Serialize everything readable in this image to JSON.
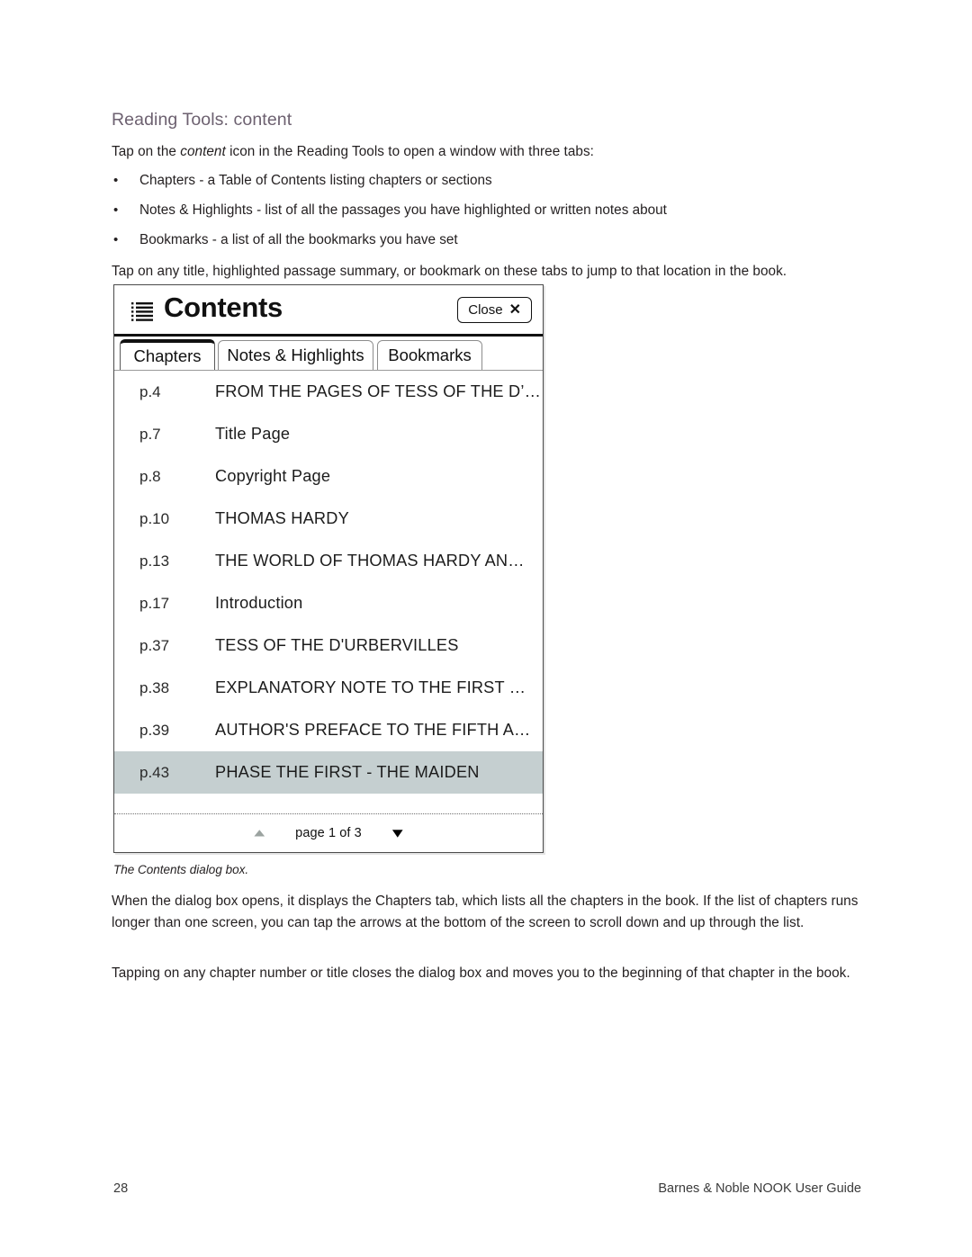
{
  "document": {
    "heading": "Reading Tools: content",
    "intro_before_italic": "Tap on the ",
    "intro_italic": "content",
    "intro_after_italic": " icon in the Reading Tools to open a window with three tabs:",
    "bullets": [
      "Chapters - a Table of Contents listing chapters or sections",
      "Notes & Highlights - list of all the passages you have highlighted or written notes about",
      "Bookmarks - a list of all the bookmarks you have set"
    ],
    "para_tap": "Tap on any title, highlighted passage summary, or bookmark on these tabs to jump to that location in the book.",
    "caption": "The Contents dialog box.",
    "para_when": "When the dialog box opens, it displays the Chapters tab, which lists all the chapters in the book. If the list of chapters runs longer than one screen, you can tap the arrows at the bottom of the screen to scroll down and up through the list.",
    "para_tapping": "Tapping on any chapter number or title closes the dialog box and moves you to the beginning of that chapter in the book."
  },
  "dialog": {
    "title": "Contents",
    "menu_icon": "list-icon",
    "close_label": "Close",
    "close_icon": "close-x-icon",
    "tabs": [
      {
        "label": "Chapters",
        "active": true
      },
      {
        "label": "Notes & Highlights",
        "active": false
      },
      {
        "label": "Bookmarks",
        "active": false
      }
    ],
    "chapters": [
      {
        "page": "p.4",
        "title": "FROM THE PAGES OF TESS OF THE D’…",
        "selected": false
      },
      {
        "page": "p.7",
        "title": "Title Page",
        "selected": false
      },
      {
        "page": "p.8",
        "title": "Copyright Page",
        "selected": false
      },
      {
        "page": "p.10",
        "title": "THOMAS HARDY",
        "selected": false
      },
      {
        "page": "p.13",
        "title": "THE WORLD OF THOMAS HARDY AN…",
        "selected": false
      },
      {
        "page": "p.17",
        "title": "Introduction",
        "selected": false
      },
      {
        "page": "p.37",
        "title": "TESS OF THE D'URBERVILLES",
        "selected": false
      },
      {
        "page": "p.38",
        "title": "EXPLANATORY NOTE TO THE FIRST …",
        "selected": false
      },
      {
        "page": "p.39",
        "title": "AUTHOR'S PREFACE TO THE FIFTH A…",
        "selected": false
      },
      {
        "page": "p.43",
        "title": "PHASE THE FIRST - THE MAIDEN",
        "selected": true
      }
    ],
    "pager": {
      "up_icon": "triangle-up-icon",
      "label": "page 1 of 3",
      "down_icon": "triangle-down-icon"
    },
    "colors": {
      "selected_row": "#c5cfd0",
      "heading": "#6d6170",
      "border": "#4a4a4a"
    }
  },
  "footer": {
    "page_number": "28",
    "guide_title": "Barnes & Noble NOOK User Guide"
  }
}
